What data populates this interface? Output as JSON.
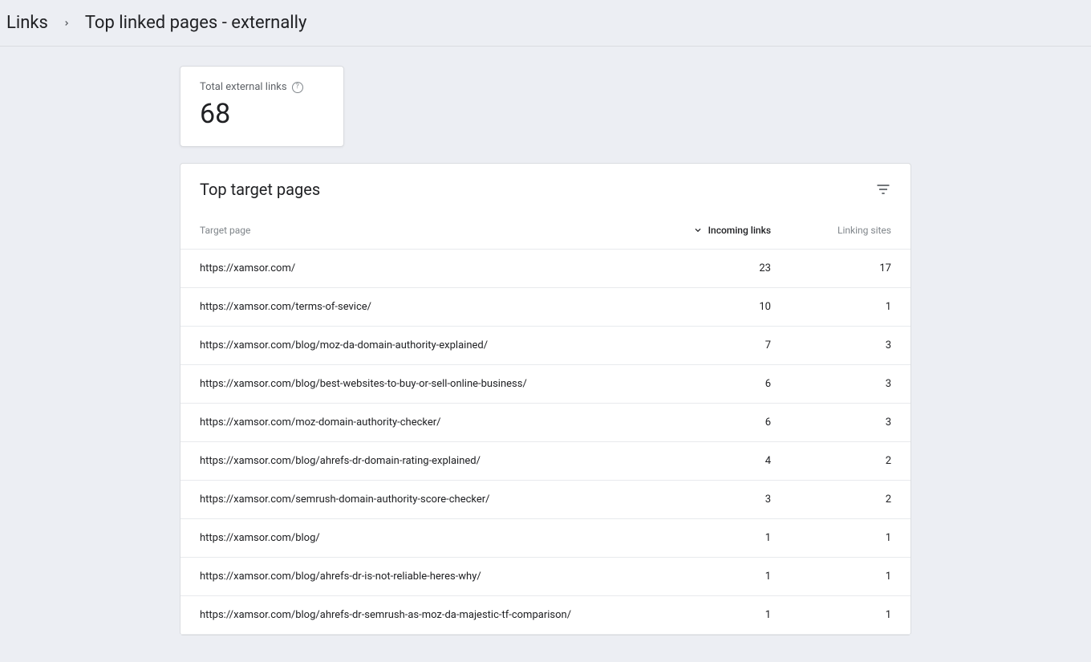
{
  "breadcrumb": {
    "parent": "Links",
    "current": "Top linked pages - externally"
  },
  "summary": {
    "label": "Total external links",
    "value": "68"
  },
  "table": {
    "title": "Top target pages",
    "columns": {
      "target": "Target page",
      "incoming": "Incoming links",
      "linking": "Linking sites"
    },
    "rows": [
      {
        "target": "https://xamsor.com/",
        "incoming": "23",
        "linking": "17"
      },
      {
        "target": "https://xamsor.com/terms-of-sevice/",
        "incoming": "10",
        "linking": "1"
      },
      {
        "target": "https://xamsor.com/blog/moz-da-domain-authority-explained/",
        "incoming": "7",
        "linking": "3"
      },
      {
        "target": "https://xamsor.com/blog/best-websites-to-buy-or-sell-online-business/",
        "incoming": "6",
        "linking": "3"
      },
      {
        "target": "https://xamsor.com/moz-domain-authority-checker/",
        "incoming": "6",
        "linking": "3"
      },
      {
        "target": "https://xamsor.com/blog/ahrefs-dr-domain-rating-explained/",
        "incoming": "4",
        "linking": "2"
      },
      {
        "target": "https://xamsor.com/semrush-domain-authority-score-checker/",
        "incoming": "3",
        "linking": "2"
      },
      {
        "target": "https://xamsor.com/blog/",
        "incoming": "1",
        "linking": "1"
      },
      {
        "target": "https://xamsor.com/blog/ahrefs-dr-is-not-reliable-heres-why/",
        "incoming": "1",
        "linking": "1"
      },
      {
        "target": "https://xamsor.com/blog/ahrefs-dr-semrush-as-moz-da-majestic-tf-comparison/",
        "incoming": "1",
        "linking": "1"
      }
    ]
  }
}
